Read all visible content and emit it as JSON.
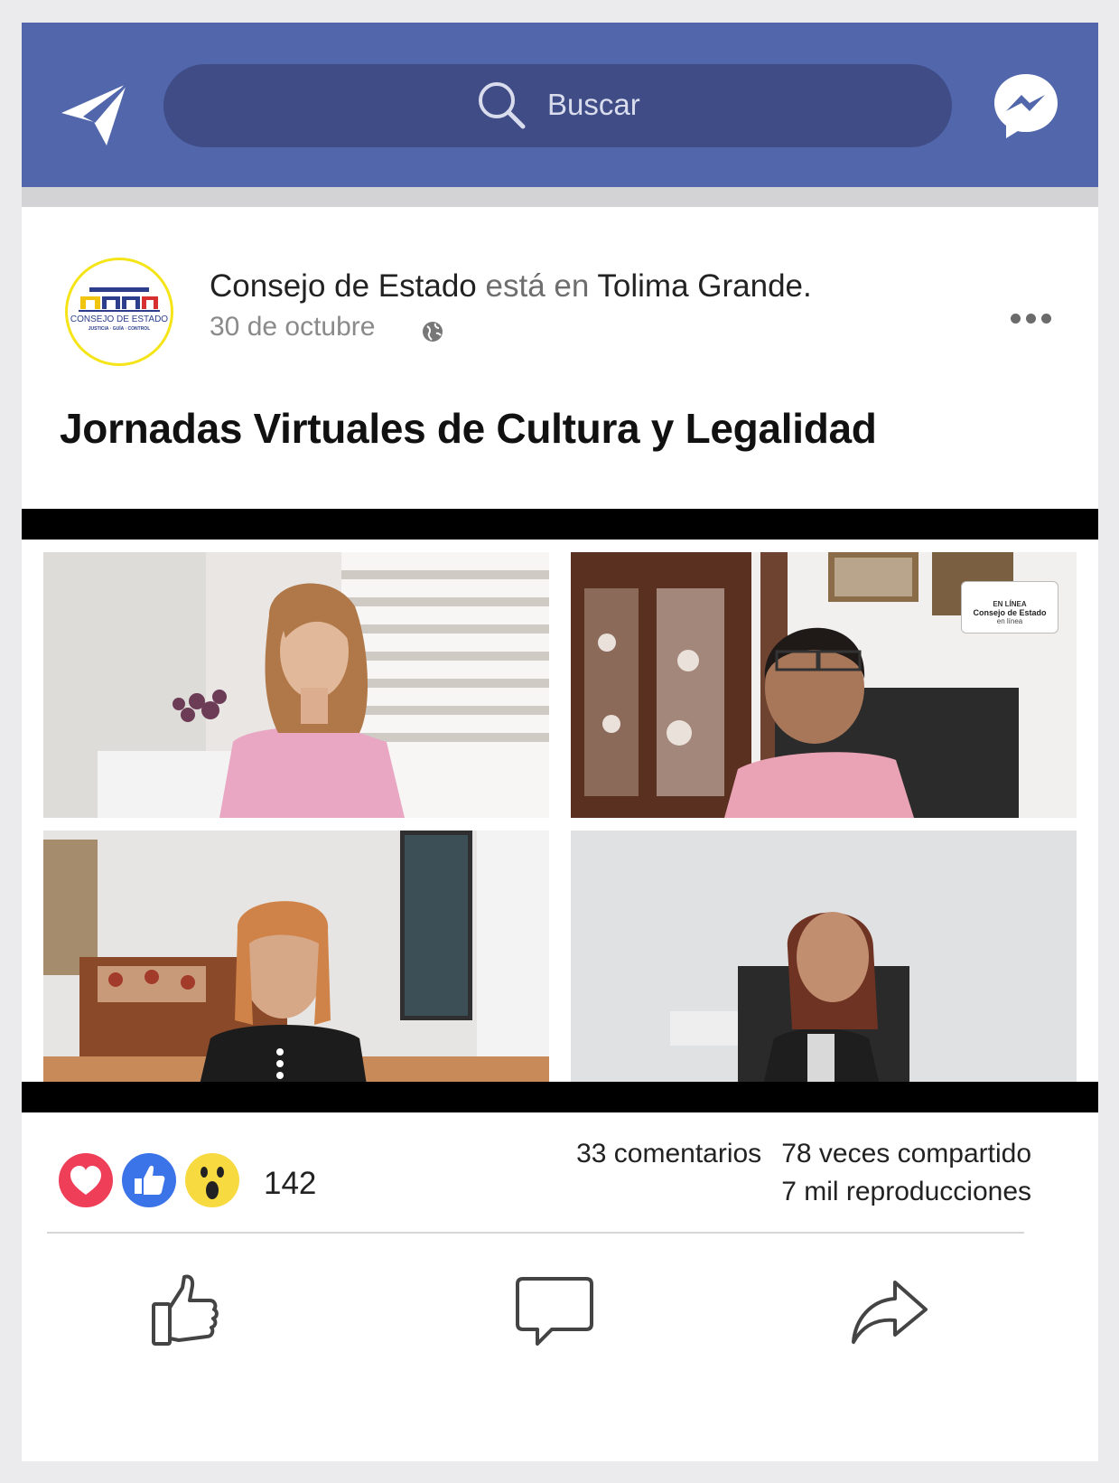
{
  "topbar": {
    "search_placeholder": "Buscar",
    "send_icon": "paper-plane-icon",
    "search_icon": "search-icon",
    "messenger_icon": "messenger-icon",
    "bar_color": "#5266ac",
    "search_color": "#3f4c86"
  },
  "post": {
    "author": "Consejo de Estado",
    "verb": "está en",
    "location": "Tolima Grande.",
    "date": "30 de octubre",
    "privacy_icon": "globe-icon",
    "more_icon": "more-horizontal-icon",
    "title": "Jornadas Virtuales de Cultura y Legalidad",
    "avatar_logo_text": "CONSEJO DE ESTADO",
    "avatar_logo_subtext": "JUSTICIA · GUÍA · CONTROL"
  },
  "video": {
    "badge_line1": "EN LÍNEA",
    "badge_line2": "Consejo de Estado",
    "badge_line3": "en línea",
    "participants": 4
  },
  "engagement": {
    "reactions": [
      "love-reaction-icon",
      "like-reaction-icon",
      "wow-reaction-icon"
    ],
    "reaction_count": "142",
    "comments": "33 comentarios",
    "shares": "78 veces compartido",
    "views": "7 mil  reproducciones"
  },
  "actions": {
    "like_icon": "thumbs-up-icon",
    "comment_icon": "comment-icon",
    "share_icon": "share-arrow-icon"
  }
}
